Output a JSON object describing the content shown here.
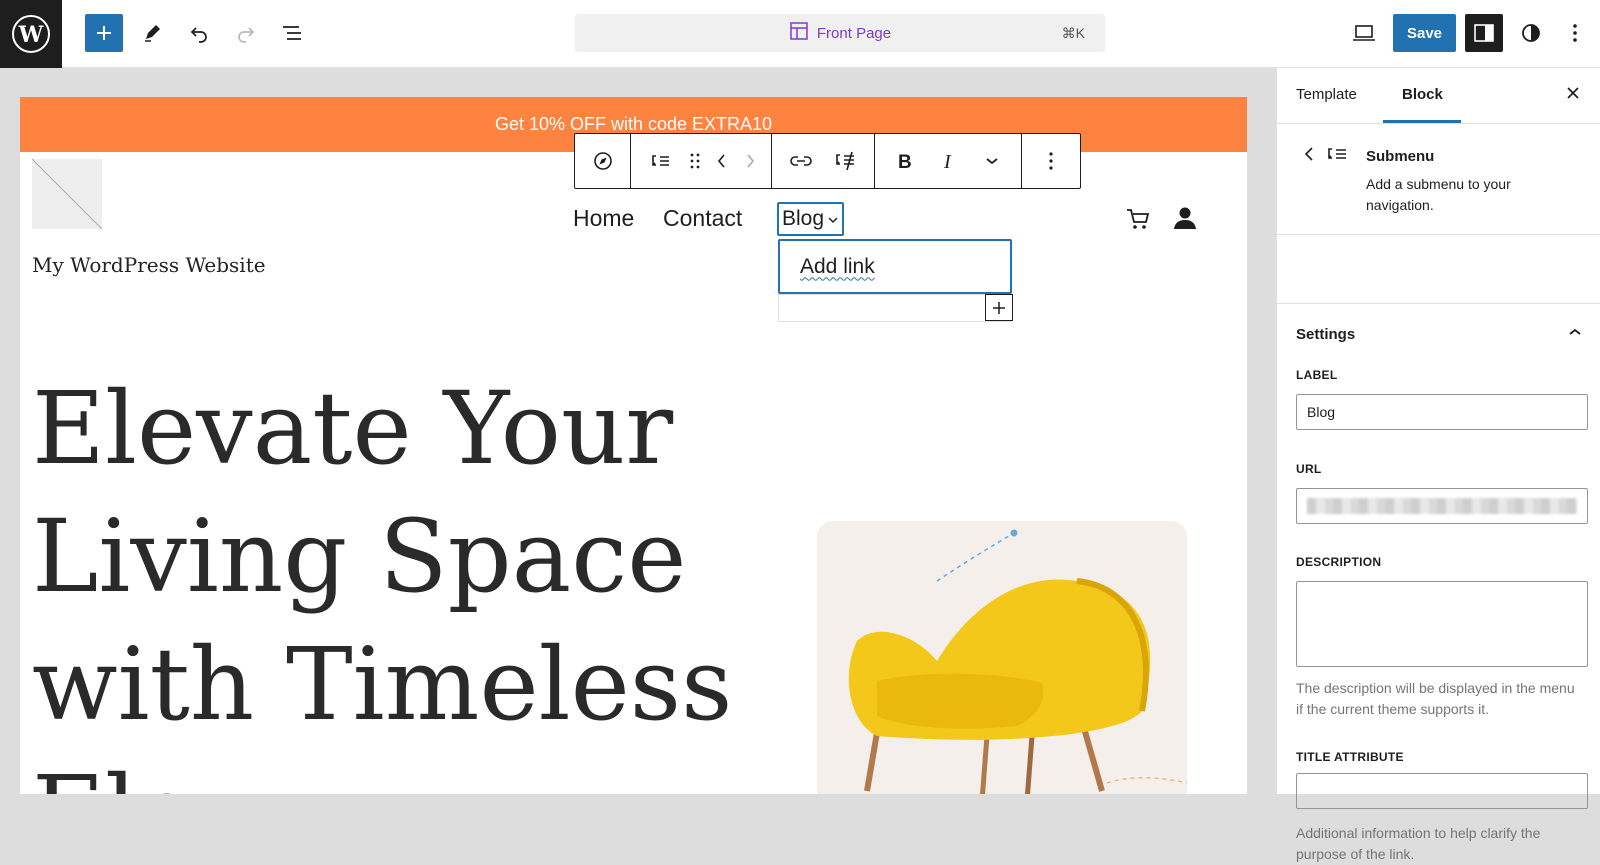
{
  "topbar": {
    "command_bar": {
      "title": "Front Page",
      "shortcut": "⌘K"
    },
    "save_label": "Save"
  },
  "canvas": {
    "promo_text": "Get 10% OFF with code EXTRA10",
    "site_title": "My WordPress Website",
    "nav": {
      "items": [
        "Home",
        "Contact"
      ],
      "active_item": "Blog"
    },
    "submenu": {
      "add_link_placeholder": "Add link"
    },
    "hero_heading": "Elevate Your Living Space with Timeless Ele"
  },
  "sidebar": {
    "tabs": [
      {
        "label": "Template"
      },
      {
        "label": "Block"
      }
    ],
    "active_tab": "Block",
    "block_card": {
      "title": "Submenu",
      "description": "Add a submenu to your navigation."
    },
    "settings": {
      "heading": "Settings",
      "label_field": {
        "label": "LABEL",
        "value": "Blog"
      },
      "url_field": {
        "label": "URL"
      },
      "description_field": {
        "label": "DESCRIPTION",
        "help": "The description will be displayed in the menu if the current theme supports it."
      },
      "title_attribute_field": {
        "label": "TITLE ATTRIBUTE",
        "help": "Additional information to help clarify the purpose of the link."
      }
    }
  },
  "colors": {
    "accent": "#2271b1",
    "promo_bg": "#ff8340",
    "command_title": "#7c3ad6"
  }
}
